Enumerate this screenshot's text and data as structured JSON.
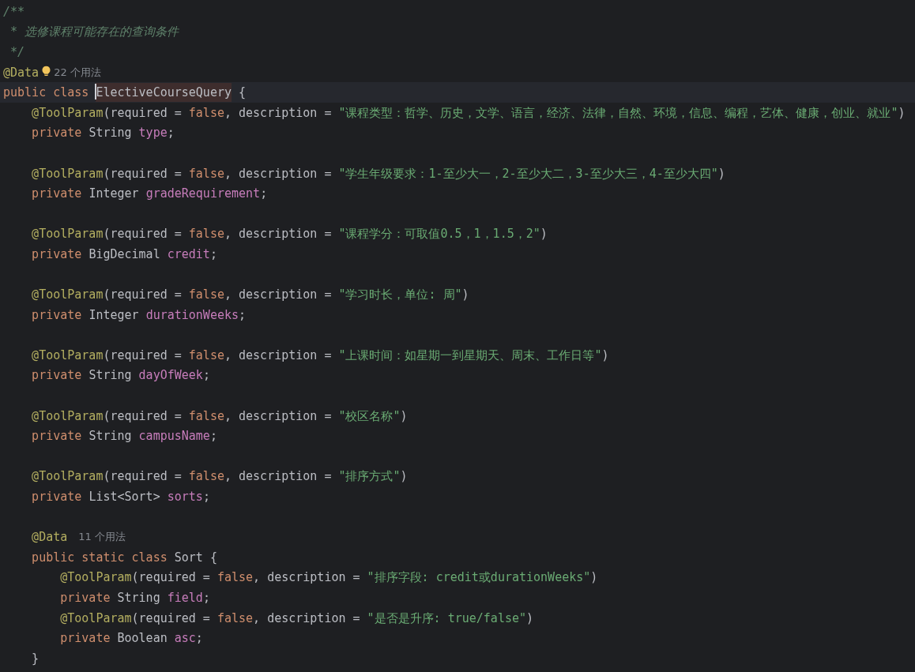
{
  "editor": {
    "lines": [
      {
        "current": false,
        "tokens": [
          {
            "kind": "doc",
            "text": "/**"
          }
        ]
      },
      {
        "current": false,
        "tokens": [
          {
            "kind": "doc",
            "text": " * 选修课程可能存在的查询条件"
          }
        ]
      },
      {
        "current": false,
        "tokens": [
          {
            "kind": "doc",
            "text": " */"
          }
        ]
      },
      {
        "current": false,
        "intention_bulb": true,
        "tokens": [
          {
            "kind": "annotation",
            "text": "@Data"
          }
        ],
        "usages": "22 个用法"
      },
      {
        "current": true,
        "caret": true,
        "tokens": [
          {
            "kind": "keyword",
            "text": "public class "
          },
          {
            "kind": "plain",
            "text": "ElectiveCourseQuery",
            "highlighted": true
          },
          {
            "kind": "plain",
            "text": " {"
          }
        ]
      },
      {
        "current": false,
        "tokens": [
          {
            "kind": "annotation",
            "text": "    @ToolParam"
          },
          {
            "kind": "plain",
            "text": "(required = "
          },
          {
            "kind": "keyword",
            "text": "false"
          },
          {
            "kind": "plain",
            "text": ", description = "
          },
          {
            "kind": "string",
            "text": "\"课程类型：哲学、历史，文学、语言，经济、法律，自然、环境，信息、编程，艺体、健康，创业、就业\""
          },
          {
            "kind": "plain",
            "text": ")"
          }
        ]
      },
      {
        "current": false,
        "tokens": [
          {
            "kind": "keyword",
            "text": "    private "
          },
          {
            "kind": "plain",
            "text": "String "
          },
          {
            "kind": "field",
            "text": "type"
          },
          {
            "kind": "plain",
            "text": ";"
          }
        ]
      },
      {
        "current": false
      },
      {
        "current": false,
        "tokens": [
          {
            "kind": "annotation",
            "text": "    @ToolParam"
          },
          {
            "kind": "plain",
            "text": "(required = "
          },
          {
            "kind": "keyword",
            "text": "false"
          },
          {
            "kind": "plain",
            "text": ", description = "
          },
          {
            "kind": "string",
            "text": "\"学生年级要求：1-至少大一，2-至少大二，3-至少大三，4-至少大四\""
          },
          {
            "kind": "plain",
            "text": ")"
          }
        ]
      },
      {
        "current": false,
        "tokens": [
          {
            "kind": "keyword",
            "text": "    private "
          },
          {
            "kind": "plain",
            "text": "Integer "
          },
          {
            "kind": "field",
            "text": "gradeRequirement"
          },
          {
            "kind": "plain",
            "text": ";"
          }
        ]
      },
      {
        "current": false
      },
      {
        "current": false,
        "tokens": [
          {
            "kind": "annotation",
            "text": "    @ToolParam"
          },
          {
            "kind": "plain",
            "text": "(required = "
          },
          {
            "kind": "keyword",
            "text": "false"
          },
          {
            "kind": "plain",
            "text": ", description = "
          },
          {
            "kind": "string",
            "text": "\"课程学分：可取值0.5，1，1.5，2\""
          },
          {
            "kind": "plain",
            "text": ")"
          }
        ]
      },
      {
        "current": false,
        "tokens": [
          {
            "kind": "keyword",
            "text": "    private "
          },
          {
            "kind": "plain",
            "text": "BigDecimal "
          },
          {
            "kind": "field",
            "text": "credit"
          },
          {
            "kind": "plain",
            "text": ";"
          }
        ]
      },
      {
        "current": false
      },
      {
        "current": false,
        "tokens": [
          {
            "kind": "annotation",
            "text": "    @ToolParam"
          },
          {
            "kind": "plain",
            "text": "(required = "
          },
          {
            "kind": "keyword",
            "text": "false"
          },
          {
            "kind": "plain",
            "text": ", description = "
          },
          {
            "kind": "string",
            "text": "\"学习时长，单位: 周\""
          },
          {
            "kind": "plain",
            "text": ")"
          }
        ]
      },
      {
        "current": false,
        "tokens": [
          {
            "kind": "keyword",
            "text": "    private "
          },
          {
            "kind": "plain",
            "text": "Integer "
          },
          {
            "kind": "field",
            "text": "durationWeeks"
          },
          {
            "kind": "plain",
            "text": ";"
          }
        ]
      },
      {
        "current": false
      },
      {
        "current": false,
        "tokens": [
          {
            "kind": "annotation",
            "text": "    @ToolParam"
          },
          {
            "kind": "plain",
            "text": "(required = "
          },
          {
            "kind": "keyword",
            "text": "false"
          },
          {
            "kind": "plain",
            "text": ", description = "
          },
          {
            "kind": "string",
            "text": "\"上课时间：如星期一到星期天、周末、工作日等\""
          },
          {
            "kind": "plain",
            "text": ")"
          }
        ]
      },
      {
        "current": false,
        "tokens": [
          {
            "kind": "keyword",
            "text": "    private "
          },
          {
            "kind": "plain",
            "text": "String "
          },
          {
            "kind": "field",
            "text": "dayOfWeek"
          },
          {
            "kind": "plain",
            "text": ";"
          }
        ]
      },
      {
        "current": false
      },
      {
        "current": false,
        "tokens": [
          {
            "kind": "annotation",
            "text": "    @ToolParam"
          },
          {
            "kind": "plain",
            "text": "(required = "
          },
          {
            "kind": "keyword",
            "text": "false"
          },
          {
            "kind": "plain",
            "text": ", description = "
          },
          {
            "kind": "string",
            "text": "\"校区名称\""
          },
          {
            "kind": "plain",
            "text": ")"
          }
        ]
      },
      {
        "current": false,
        "tokens": [
          {
            "kind": "keyword",
            "text": "    private "
          },
          {
            "kind": "plain",
            "text": "String "
          },
          {
            "kind": "field",
            "text": "campusName"
          },
          {
            "kind": "plain",
            "text": ";"
          }
        ]
      },
      {
        "current": false
      },
      {
        "current": false,
        "tokens": [
          {
            "kind": "annotation",
            "text": "    @ToolParam"
          },
          {
            "kind": "plain",
            "text": "(required = "
          },
          {
            "kind": "keyword",
            "text": "false"
          },
          {
            "kind": "plain",
            "text": ", description = "
          },
          {
            "kind": "string",
            "text": "\"排序方式\""
          },
          {
            "kind": "plain",
            "text": ")"
          }
        ]
      },
      {
        "current": false,
        "tokens": [
          {
            "kind": "keyword",
            "text": "    private "
          },
          {
            "kind": "plain",
            "text": "List<Sort> "
          },
          {
            "kind": "field",
            "text": "sorts"
          },
          {
            "kind": "plain",
            "text": ";"
          }
        ]
      },
      {
        "current": false
      },
      {
        "current": false,
        "tokens": [
          {
            "kind": "annotation",
            "text": "    @Data"
          }
        ],
        "usages": "11 个用法"
      },
      {
        "current": false,
        "tokens": [
          {
            "kind": "keyword",
            "text": "    public static class "
          },
          {
            "kind": "plain",
            "text": "Sort {"
          }
        ]
      },
      {
        "current": false,
        "tokens": [
          {
            "kind": "annotation",
            "text": "        @ToolParam"
          },
          {
            "kind": "plain",
            "text": "(required = "
          },
          {
            "kind": "keyword",
            "text": "false"
          },
          {
            "kind": "plain",
            "text": ", description = "
          },
          {
            "kind": "string",
            "text": "\"排序字段: credit或durationWeeks\""
          },
          {
            "kind": "plain",
            "text": ")"
          }
        ]
      },
      {
        "current": false,
        "tokens": [
          {
            "kind": "keyword",
            "text": "        private "
          },
          {
            "kind": "plain",
            "text": "String "
          },
          {
            "kind": "field",
            "text": "field"
          },
          {
            "kind": "plain",
            "text": ";"
          }
        ]
      },
      {
        "current": false,
        "tokens": [
          {
            "kind": "annotation",
            "text": "        @ToolParam"
          },
          {
            "kind": "plain",
            "text": "(required = "
          },
          {
            "kind": "keyword",
            "text": "false"
          },
          {
            "kind": "plain",
            "text": ", description = "
          },
          {
            "kind": "string",
            "text": "\"是否是升序: true/false\""
          },
          {
            "kind": "plain",
            "text": ")"
          }
        ]
      },
      {
        "current": false,
        "tokens": [
          {
            "kind": "keyword",
            "text": "        private "
          },
          {
            "kind": "plain",
            "text": "Boolean "
          },
          {
            "kind": "field",
            "text": "asc"
          },
          {
            "kind": "plain",
            "text": ";"
          }
        ]
      },
      {
        "current": false,
        "tokens": [
          {
            "kind": "plain",
            "text": "    }"
          }
        ]
      }
    ]
  }
}
